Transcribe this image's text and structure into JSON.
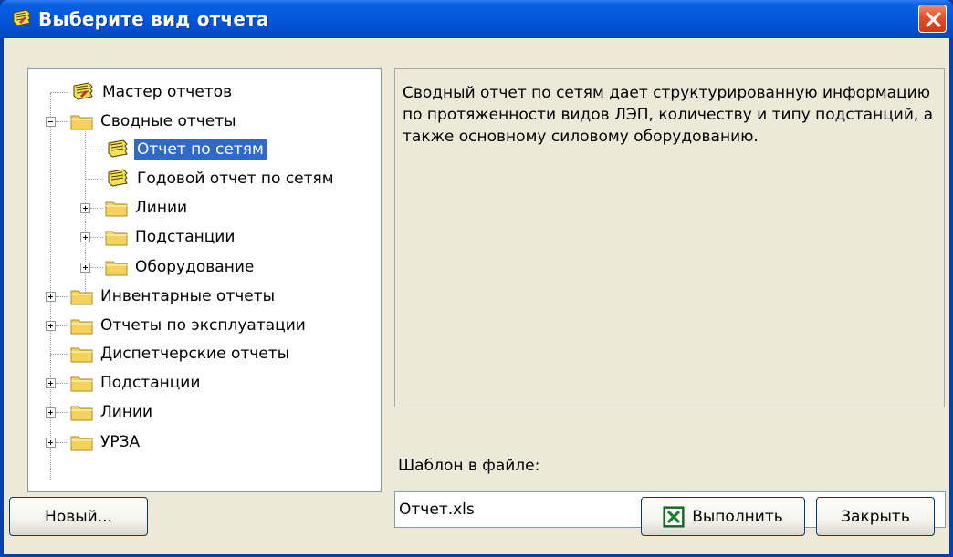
{
  "window": {
    "title": "Выберите вид отчета"
  },
  "tree": {
    "items": [
      {
        "label": "Мастер отчетов"
      },
      {
        "label": "Сводные отчеты"
      },
      {
        "label": "Отчет по сетям"
      },
      {
        "label": "Годовой отчет по сетям"
      },
      {
        "label": "Линии"
      },
      {
        "label": "Подстанции"
      },
      {
        "label": "Оборудование"
      },
      {
        "label": "Инвентарные отчеты"
      },
      {
        "label": "Отчеты по эксплуатации"
      },
      {
        "label": "Диспетчерские отчеты"
      },
      {
        "label": "Подстанции"
      },
      {
        "label": "Линии"
      },
      {
        "label": "УРЗА"
      }
    ],
    "selected": "Отчет по сетям"
  },
  "description": {
    "text": "Сводный отчет по сетям дает структурированную информацию по протяженности видов ЛЭП, количеству и типу подстанций, а также основному силовому оборудованию."
  },
  "template": {
    "label": "Шаблон в файле:",
    "value": "Отчет.xls"
  },
  "buttons": {
    "new": "Новый...",
    "run": "Выполнить",
    "close": "Закрыть"
  },
  "colors": {
    "titlebar": "#0457dd",
    "selection": "#316ac5",
    "dialog_bg": "#ece9d8",
    "close_button": "#e2502a"
  },
  "icons": {
    "title": "report-scroll-icon",
    "close": "close-icon",
    "run": "excel-icon"
  }
}
